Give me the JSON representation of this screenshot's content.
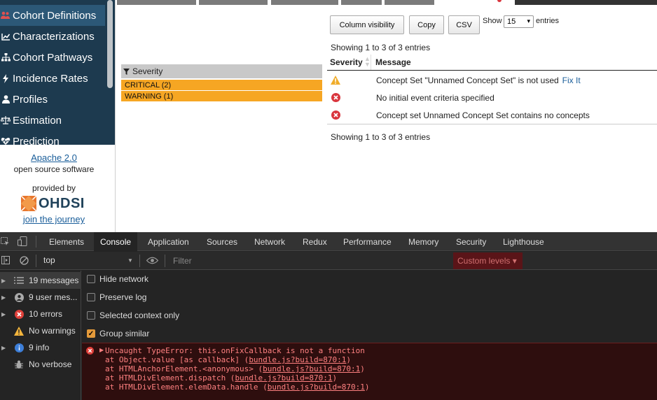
{
  "sidebar": {
    "items": [
      {
        "label": "Cohort Definitions",
        "icon": "users-icon"
      },
      {
        "label": "Characterizations",
        "icon": "chart-line-icon"
      },
      {
        "label": "Cohort Pathways",
        "icon": "sitemap-icon"
      },
      {
        "label": "Incidence Rates",
        "icon": "bolt-icon"
      },
      {
        "label": "Profiles",
        "icon": "user-icon"
      },
      {
        "label": "Estimation",
        "icon": "balance-scale-icon"
      },
      {
        "label": "Prediction",
        "icon": "heartbeat-icon"
      }
    ],
    "footer": {
      "license_link": "Apache 2.0",
      "license_text": "open source software",
      "provided_by": "provided by",
      "logo_text": "OHDSI",
      "journey_link": "join the journey"
    }
  },
  "toolbar": {
    "column_visibility": "Column visibility",
    "copy": "Copy",
    "csv": "CSV",
    "show_label": "Show",
    "show_value": "15",
    "entries_label": "entries"
  },
  "showing_top": "Showing 1 to 3 of 3 entries",
  "showing_bottom": "Showing 1 to 3 of 3 entries",
  "facet": {
    "title": "Severity",
    "options": [
      "CRITICAL (2)",
      "WARNING (1)"
    ]
  },
  "table": {
    "headers": {
      "severity": "Severity",
      "message": "Message"
    },
    "rows": [
      {
        "severity": "warning",
        "message": "Concept Set \"Unnamed Concept Set\" is not used",
        "action": "Fix It"
      },
      {
        "severity": "critical",
        "message": "No initial event criteria specified",
        "action": ""
      },
      {
        "severity": "critical",
        "message": "Concept set Unnamed Concept Set contains no concepts",
        "action": ""
      }
    ]
  },
  "devtools": {
    "tabs": [
      "Elements",
      "Console",
      "Application",
      "Sources",
      "Network",
      "Redux",
      "Performance",
      "Memory",
      "Security",
      "Lighthouse"
    ],
    "active_tab": "Console",
    "context": "top",
    "filter_placeholder": "Filter",
    "custom_levels": "Custom levels ▾",
    "side": [
      {
        "label": "19 messages",
        "icon": "list-icon"
      },
      {
        "label": "9 user mes...",
        "icon": "user-circle-icon"
      },
      {
        "label": "10 errors",
        "icon": "error-icon"
      },
      {
        "label": "No warnings",
        "icon": "warning-icon"
      },
      {
        "label": "9 info",
        "icon": "info-icon"
      },
      {
        "label": "No verbose",
        "icon": "bug-icon"
      }
    ],
    "options": [
      {
        "label": "Hide network",
        "checked": false
      },
      {
        "label": "Preserve log",
        "checked": false
      },
      {
        "label": "Selected context only",
        "checked": false
      },
      {
        "label": "Group similar",
        "checked": true
      }
    ],
    "error": {
      "headline": "Uncaught TypeError: this.onFixCallback is not a function",
      "stack": [
        {
          "prefix": "    at Object.value [as callback] (",
          "link": "bundle.js?build=870:1",
          "suffix": ")"
        },
        {
          "prefix": "    at HTMLAnchorElement.<anonymous> (",
          "link": "bundle.js?build=870:1",
          "suffix": ")"
        },
        {
          "prefix": "    at HTMLDivElement.dispatch (",
          "link": "bundle.js?build=870:1",
          "suffix": ")"
        },
        {
          "prefix": "    at HTMLDivElement.elemData.handle (",
          "link": "bundle.js?build=870:1",
          "suffix": ")"
        }
      ]
    }
  },
  "colors": {
    "sidebar_bg": "#1d3a4f",
    "facet_orange": "#f6a623",
    "critical_red": "#d9363e",
    "warning_orange": "#f0ad2b",
    "console_error_text": "#ff8080"
  }
}
